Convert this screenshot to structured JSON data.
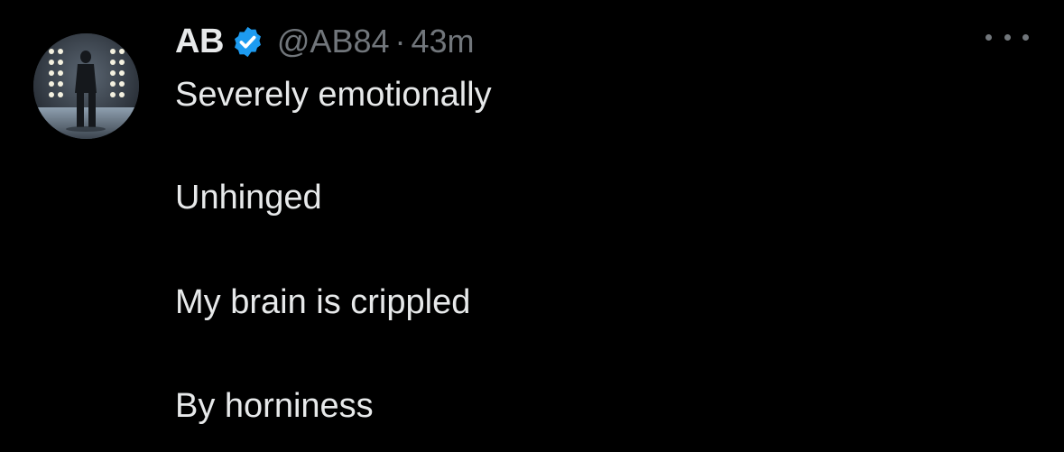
{
  "tweet": {
    "author": {
      "display_name": "AB",
      "handle": "@AB84",
      "verified": true,
      "avatar_icon": "person-on-stage-avatar"
    },
    "separator": "·",
    "timestamp": "43m",
    "more_icon": "more-horizontal-icon",
    "text_lines": [
      "Severely emotionally",
      "Unhinged",
      "My brain is crippled",
      "By horniness"
    ]
  },
  "colors": {
    "background": "#000000",
    "text_primary": "#e7e9ea",
    "text_secondary": "#71767b",
    "verified_badge": "#1d9bf0"
  }
}
